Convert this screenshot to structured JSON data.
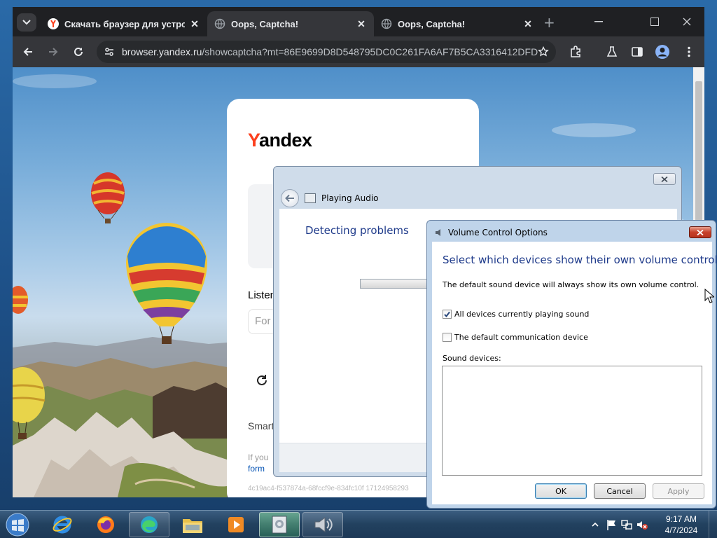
{
  "browser": {
    "tabs": [
      {
        "title": "Скачать браузер для устройс",
        "favicon": "yandex-favicon",
        "active": false
      },
      {
        "title": "Oops, Captcha!",
        "favicon": "globe-icon",
        "active": true
      },
      {
        "title": "Oops, Captcha!",
        "favicon": "globe-icon",
        "active": false
      }
    ],
    "new_tab": "+",
    "url_domain": "browser.yandex.ru",
    "url_path": "/showcaptcha?mt=86E9699D8D548795DC0C261FA6AF7B5CA3316412DFD...",
    "toolbar_icons": [
      "back-icon",
      "forward-icon",
      "reload-icon",
      "site-info-icon",
      "bookmark-star-icon",
      "extensions-icon",
      "labs-icon",
      "side-panel-icon",
      "profile-icon",
      "menu-icon"
    ]
  },
  "captcha_page": {
    "logo_first": "Y",
    "logo_rest": "andex",
    "listen_label": "Listen",
    "field_placeholder": "For",
    "smart_text": "Smart",
    "if_you_text": "If you",
    "form_link": "form",
    "hash": "4c19ac4-f537874a-68fccf9e-834fc10f 17124958293"
  },
  "troubleshooter": {
    "title": "Playing Audio",
    "status": "Detecting problems"
  },
  "volume_dialog": {
    "title": "Volume Control Options",
    "heading": "Select which devices show their own volume control",
    "note": "The default sound device will always show its own volume control.",
    "checkbox_all": {
      "label": "All devices currently playing sound",
      "checked": true
    },
    "checkbox_default_comm": {
      "label": "The default communication device",
      "checked": false
    },
    "sound_devices_label": "Sound devices:",
    "buttons": {
      "ok": "OK",
      "cancel": "Cancel",
      "apply": "Apply"
    }
  },
  "taskbar": {
    "items": [
      "start-orb-icon",
      "internet-explorer-icon",
      "firefox-icon",
      "edge-icon",
      "file-explorer-icon",
      "media-player-icon",
      "troubleshooter-icon",
      "volume-mixer-icon"
    ],
    "tray_icons": [
      "show-hidden-icons-chevron",
      "action-center-flag-icon",
      "network-icon",
      "volume-muted-icon"
    ],
    "time": "9:17 AM",
    "date": "4/7/2024"
  },
  "colors": {
    "accent_yandex": "#fc3f1d",
    "dialog_heading": "#1e3a8a",
    "browser_dark": "#35363a"
  }
}
